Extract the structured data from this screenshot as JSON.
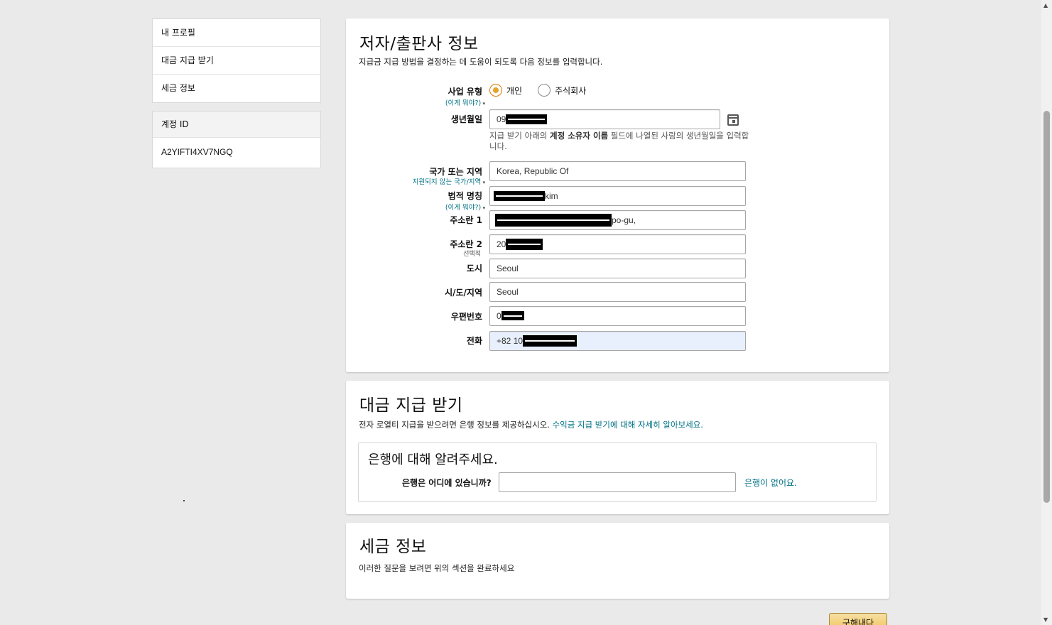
{
  "sidebar": {
    "nav": [
      {
        "label": "내 프로필"
      },
      {
        "label": "대금 지급 받기"
      },
      {
        "label": "세금 정보"
      }
    ],
    "account_header": "계정 ID",
    "account_id": "A2YIFTI4XV7NGQ"
  },
  "publisher": {
    "title": "저자/출판사 정보",
    "subtitle": "지급금 지급 방법을 결정하는 데 도움이 되도록 다음 정보를 입력합니다.",
    "business_type_label": "사업 유형",
    "business_type_hint": "(이게 뭐야?)",
    "options": [
      {
        "label": "개인",
        "selected": true
      },
      {
        "label": "주식회사",
        "selected": false
      }
    ],
    "dob_label": "생년월일",
    "dob_value": "09",
    "dob_note_pre": "지급 받기 아래의 ",
    "dob_note_bold": "계정 소유자 이름",
    "dob_note_post": " 필드에 나열된 사람의 생년월일을 입력합니다.",
    "country_label": "국가 또는 지역",
    "country_hint": "지원되지 않는 국가/지역",
    "country_value": "Korea, Republic Of",
    "legal_name_label": "법적 명칭",
    "legal_name_hint": "(이게 뭐야?)",
    "legal_name_value": "kim",
    "address1_label": "주소란 1",
    "address1_value": "po-gu,",
    "address2_label": "주소란 2",
    "address2_optional": "선택적",
    "address2_value": "20",
    "city_label": "도시",
    "city_value": "Seoul",
    "state_label": "시/도/지역",
    "state_value": "Seoul",
    "postal_label": "우편번호",
    "postal_value": "0",
    "phone_label": "전화",
    "phone_value": "+82 10"
  },
  "payment": {
    "title": "대금 지급 받기",
    "subtitle": "전자 로열티 지급을 받으려면 은행 정보를 제공하십시오.",
    "learn_more": "수익금 지급 받기에 대해 자세히 알아보세요.",
    "bank_box_title": "은행에 대해 알려주세요.",
    "bank_location_label": "은행은 어디에 있습니까?",
    "bank_location_value": "",
    "no_bank_link": "은행이 없어요."
  },
  "tax": {
    "title": "세금 정보",
    "subtitle": "이러한 질문을 보려면 위의 섹션을 완료하세요"
  },
  "submit_label": "구해내다"
}
